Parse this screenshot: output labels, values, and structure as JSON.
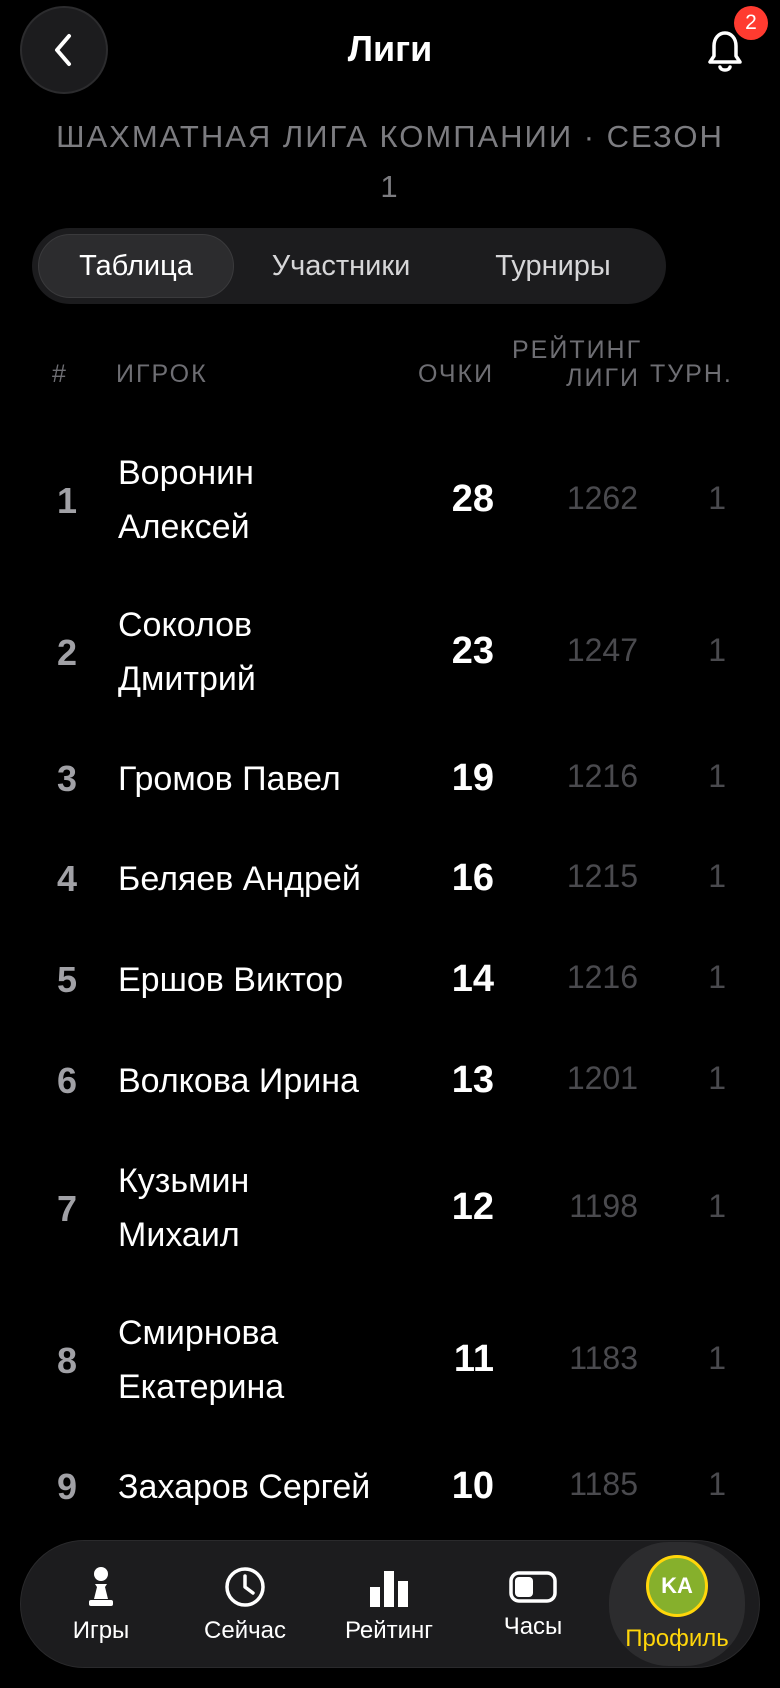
{
  "header": {
    "title": "Лиги",
    "notifications_count": "2"
  },
  "subtitle_line1": "ШАХМАТНАЯ ЛИГА КОМПАНИИ · СЕЗОН",
  "subtitle_line2": "1",
  "tabs": [
    {
      "label": "Таблица",
      "active": true
    },
    {
      "label": "Участники",
      "active": false
    },
    {
      "label": "Турниры",
      "active": false
    }
  ],
  "table": {
    "columns": {
      "rank": "#",
      "player": "ИГРОК",
      "points": "ОЧКИ",
      "rating_line1": "РЕЙТИНГ",
      "rating_line2": "ЛИГИ",
      "tournaments": "ТУРН."
    },
    "rows": [
      {
        "rank": "1",
        "name1": "Воронин",
        "name2": "Алексей",
        "points": "28",
        "rating": "1262",
        "tournaments": "1"
      },
      {
        "rank": "2",
        "name1": "Соколов",
        "name2": "Дмитрий",
        "points": "23",
        "rating": "1247",
        "tournaments": "1"
      },
      {
        "rank": "3",
        "name1": "Громов Павел",
        "name2": "",
        "points": "19",
        "rating": "1216",
        "tournaments": "1"
      },
      {
        "rank": "4",
        "name1": "Беляев Андрей",
        "name2": "",
        "points": "16",
        "rating": "1215",
        "tournaments": "1"
      },
      {
        "rank": "5",
        "name1": "Ершов Виктор",
        "name2": "",
        "points": "14",
        "rating": "1216",
        "tournaments": "1"
      },
      {
        "rank": "6",
        "name1": "Волкова Ирина",
        "name2": "",
        "points": "13",
        "rating": "1201",
        "tournaments": "1"
      },
      {
        "rank": "7",
        "name1": "Кузьмин",
        "name2": "Михаил",
        "points": "12",
        "rating": "1198",
        "tournaments": "1"
      },
      {
        "rank": "8",
        "name1": "Смирнова",
        "name2": "Екатерина",
        "points": "11",
        "rating": "1183",
        "tournaments": "1"
      },
      {
        "rank": "9",
        "name1": "Захаров Сергей",
        "name2": "",
        "points": "10",
        "rating": "1185",
        "tournaments": "1"
      }
    ]
  },
  "bottom_nav": [
    {
      "label": "Игры",
      "icon": "pawn-icon"
    },
    {
      "label": "Сейчас",
      "icon": "clock-icon"
    },
    {
      "label": "Рейтинг",
      "icon": "bar-chart-icon"
    },
    {
      "label": "Часы",
      "icon": "chess-clock-icon"
    },
    {
      "label": "Профиль",
      "icon": "avatar",
      "avatar_initials": "KA",
      "active": true
    }
  ],
  "colors": {
    "accent": "#ffd60a",
    "badge": "#ff3b30",
    "avatar_bg": "#86b02c"
  }
}
